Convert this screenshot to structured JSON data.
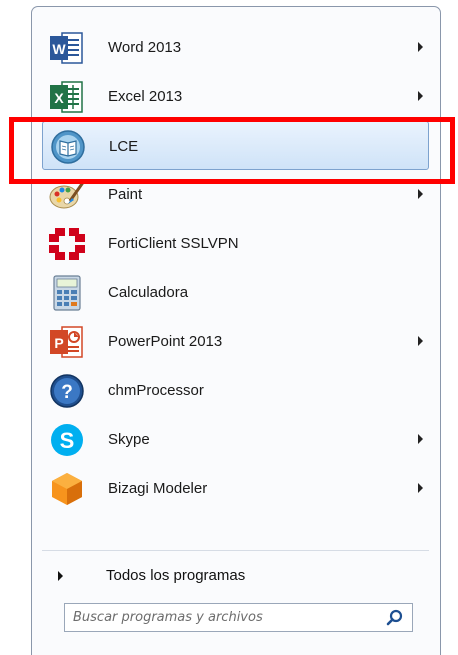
{
  "programs": [
    {
      "label": "Word 2013",
      "icon": "word-icon",
      "has_submenu": true,
      "selected": false
    },
    {
      "label": "Excel 2013",
      "icon": "excel-icon",
      "has_submenu": true,
      "selected": false
    },
    {
      "label": "LCE",
      "icon": "lce-icon",
      "has_submenu": false,
      "selected": true
    },
    {
      "label": "Paint",
      "icon": "paint-icon",
      "has_submenu": true,
      "selected": false
    },
    {
      "label": "FortiClient SSLVPN",
      "icon": "forticlient-icon",
      "has_submenu": false,
      "selected": false
    },
    {
      "label": "Calculadora",
      "icon": "calculator-icon",
      "has_submenu": false,
      "selected": false
    },
    {
      "label": "PowerPoint 2013",
      "icon": "powerpoint-icon",
      "has_submenu": true,
      "selected": false
    },
    {
      "label": "chmProcessor",
      "icon": "help-icon",
      "has_submenu": false,
      "selected": false
    },
    {
      "label": "Skype",
      "icon": "skype-icon",
      "has_submenu": true,
      "selected": false
    },
    {
      "label": "Bizagi Modeler",
      "icon": "bizagi-icon",
      "has_submenu": true,
      "selected": false
    }
  ],
  "all_programs": {
    "label": "Todos los programas"
  },
  "search": {
    "placeholder": "Buscar programas y archivos",
    "value": ""
  },
  "highlight": {
    "target": "LCE",
    "color": "#ff0000"
  },
  "colors": {
    "selection_border": "#7da2ce",
    "menu_border": "#8a97ab"
  }
}
